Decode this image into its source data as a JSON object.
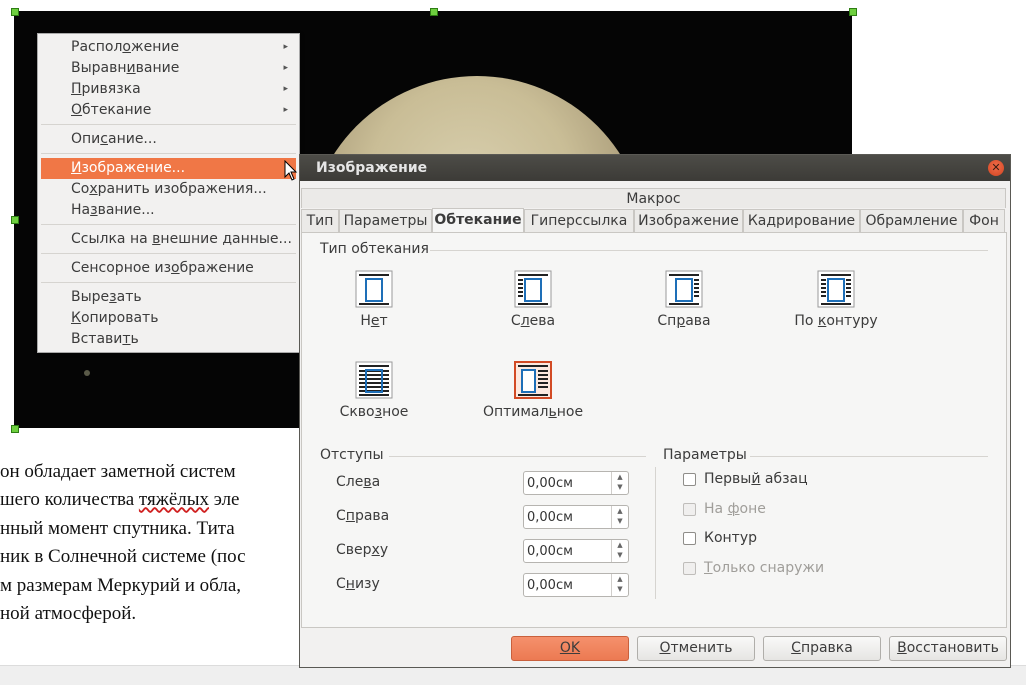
{
  "document": {
    "text_lines": [
      "он обладает заметной систем",
      "шего количества тяжёлых эле",
      "нный момент спутника. Тита",
      "ник в Солнечной системе (пос",
      "м размерам Меркурий и обла,",
      "ной атмосферой."
    ]
  },
  "context_menu": {
    "items": [
      {
        "label": "Расположение",
        "submenu": true
      },
      {
        "label": "Выравнивание",
        "submenu": true
      },
      {
        "label": "Привязка",
        "submenu": true
      },
      {
        "label": "Обтекание",
        "submenu": true
      },
      {
        "label": "Описание..."
      },
      {
        "label": "Изображение...",
        "highlighted": true
      },
      {
        "label": "Сохранить изображения..."
      },
      {
        "label": "Название..."
      },
      {
        "label": "Ссылка на внешние данные..."
      },
      {
        "label": "Сенсорное изображение"
      },
      {
        "label": "Вырезать"
      },
      {
        "label": "Копировать"
      },
      {
        "label": "Вставить"
      }
    ],
    "submenu_arrow": "▸"
  },
  "dialog": {
    "title": "Изображение",
    "close_glyph": "✕",
    "macro_tab": "Макрос",
    "tabs": [
      "Тип",
      "Параметры",
      "Обтекание",
      "Гиперссылка",
      "Изображение",
      "Кадрирование",
      "Обрамление",
      "Фон"
    ],
    "active_tab": "Обтекание",
    "wrap_section": {
      "title": "Тип обтекания",
      "options": [
        {
          "label": "Нет",
          "icon": "wrap-none-icon"
        },
        {
          "label": "Слева",
          "icon": "wrap-left-icon"
        },
        {
          "label": "Справа",
          "icon": "wrap-right-icon"
        },
        {
          "label": "По контуру",
          "icon": "wrap-parallel-icon"
        },
        {
          "label": "Сквозное",
          "icon": "wrap-through-icon"
        },
        {
          "label": "Оптимальное",
          "icon": "wrap-optimal-icon",
          "selected": true
        }
      ]
    },
    "spacing_section": {
      "title": "Отступы",
      "fields": [
        {
          "label": "Слева",
          "value": "0,00см"
        },
        {
          "label": "Справа",
          "value": "0,00см"
        },
        {
          "label": "Сверху",
          "value": "0,00см"
        },
        {
          "label": "Снизу",
          "value": "0,00см"
        }
      ]
    },
    "options_section": {
      "title": "Параметры",
      "checkboxes": [
        {
          "label": "Первый абзац",
          "checked": false,
          "enabled": true
        },
        {
          "label": "На фоне",
          "checked": false,
          "enabled": false
        },
        {
          "label": "Контур",
          "checked": false,
          "enabled": true
        },
        {
          "label": "Только снаружи",
          "checked": false,
          "enabled": false
        }
      ]
    },
    "buttons": {
      "ok": "OK",
      "cancel": "Отменить",
      "help": "Справка",
      "reset": "Восстановить"
    }
  },
  "colors": {
    "accent": "#f07746",
    "titlebar": "#3c3b37",
    "selection_icon": "#1e6fb8"
  }
}
